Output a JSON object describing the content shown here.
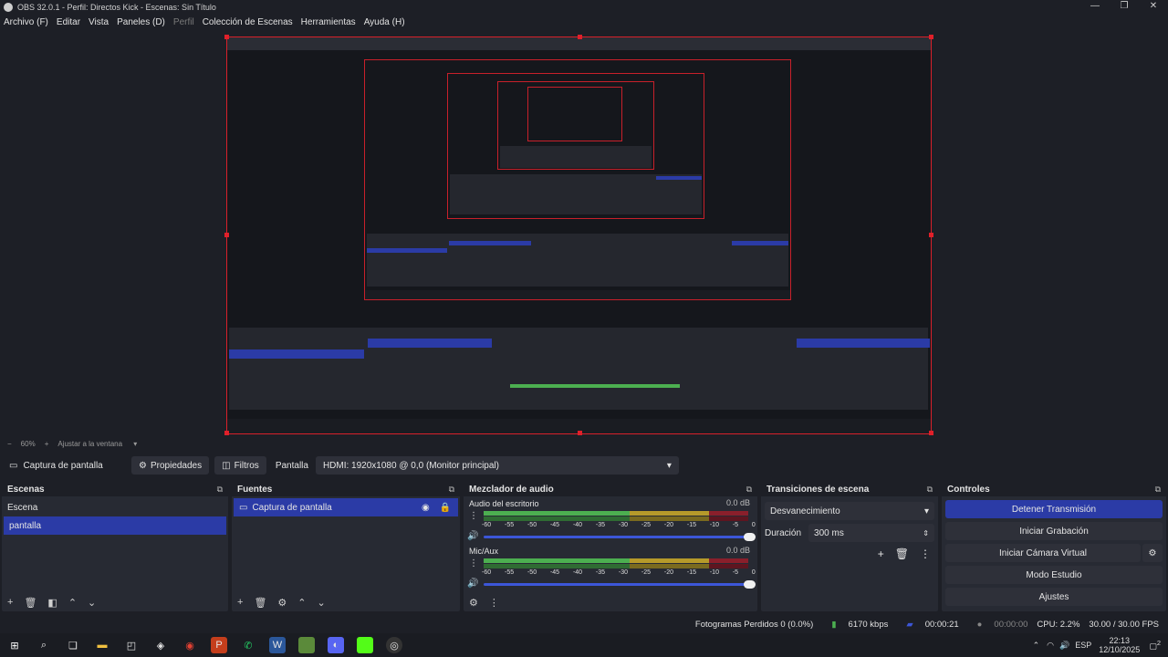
{
  "window": {
    "title": "OBS 32.0.1 - Perfil: Directos Kick - Escenas: Sin Título",
    "controls": [
      "—",
      "❐",
      "✕"
    ]
  },
  "menu": [
    {
      "label": "Archivo (F)",
      "enabled": true
    },
    {
      "label": "Editar",
      "enabled": true
    },
    {
      "label": "Vista",
      "enabled": true
    },
    {
      "label": "Paneles (D)",
      "enabled": true
    },
    {
      "label": "Perfil",
      "enabled": false
    },
    {
      "label": "Colección de Escenas",
      "enabled": true
    },
    {
      "label": "Herramientas",
      "enabled": true
    },
    {
      "label": "Ayuda (H)",
      "enabled": true
    }
  ],
  "zoom": {
    "minus": "−",
    "value": "60%",
    "plus": "+",
    "fit": "Ajustar a la ventana"
  },
  "sourcebar": {
    "source_name": "Captura de pantalla",
    "properties": "Propiedades",
    "filters": "Filtros",
    "display_label": "Pantalla",
    "display_value": "HDMI: 1920x1080 @ 0,0 (Monitor principal)"
  },
  "scenes": {
    "title": "Escenas",
    "items": [
      {
        "label": "Escena",
        "selected": false
      },
      {
        "label": "pantalla",
        "selected": true
      }
    ]
  },
  "sources": {
    "title": "Fuentes",
    "items": [
      {
        "label": "Captura de pantalla",
        "selected": true
      }
    ]
  },
  "mixer": {
    "title": "Mezclador de audio",
    "ticks": [
      "-60",
      "-55",
      "-50",
      "-45",
      "-40",
      "-35",
      "-30",
      "-25",
      "-20",
      "-15",
      "-10",
      "-5",
      "0"
    ],
    "tracks": [
      {
        "name": "Audio del escritorio",
        "db": "0.0 dB"
      },
      {
        "name": "Mic/Aux",
        "db": "0.0 dB"
      }
    ]
  },
  "transitions": {
    "title": "Transiciones de escena",
    "selected": "Desvanecimiento",
    "duration_label": "Duración",
    "duration_value": "300 ms"
  },
  "controls": {
    "title": "Controles",
    "stop_stream": "Detener Transmisión",
    "start_recording": "Iniciar Grabación",
    "virtual_cam": "Iniciar Cámara Virtual",
    "studio_mode": "Modo Estudio",
    "settings": "Ajustes"
  },
  "status": {
    "dropped_frames": "Fotogramas Perdidos 0 (0.0%)",
    "bitrate": "6170 kbps",
    "stream_time": "00:00:21",
    "rec_time": "00:00:00",
    "cpu": "CPU: 2.2%",
    "fps": "30.00 / 30.00 FPS"
  },
  "tray": {
    "lang": "ESP",
    "time": "22:13",
    "date": "12/10/2025",
    "notifications": "2"
  },
  "colors": {
    "accent": "#2b3ba6",
    "panel": "#272a33",
    "background": "#1d1f26",
    "selection_border": "#d8202a"
  }
}
